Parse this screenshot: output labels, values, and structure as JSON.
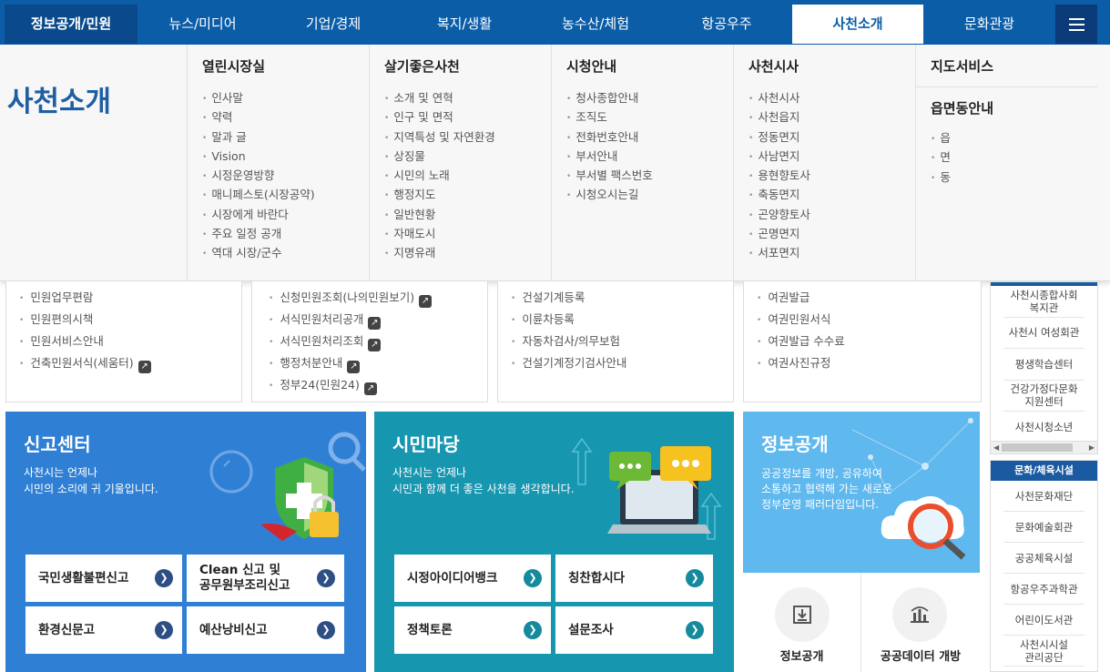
{
  "nav": {
    "items": [
      "정보공개/민원",
      "뉴스/미디어",
      "기업/경제",
      "복지/생활",
      "농수산/체험",
      "항공우주",
      "사천소개",
      "문화관광"
    ],
    "active": "사천소개"
  },
  "mega": {
    "title": "사천소개",
    "columns": [
      {
        "title": "열린시장실",
        "items": [
          "인사말",
          "약력",
          "말과 글",
          "Vision",
          "시정운영방향",
          "매니페스토(시장공약)",
          "시장에게 바란다",
          "주요 일정 공개",
          "역대 시장/군수"
        ]
      },
      {
        "title": "살기좋은사천",
        "items": [
          "소개 및 연혁",
          "인구 및 면적",
          "지역특성 및 자연환경",
          "상징물",
          "시민의 노래",
          "행정지도",
          "일반현황",
          "자매도시",
          "지명유래"
        ]
      },
      {
        "title": "시청안내",
        "items": [
          "청사종합안내",
          "조직도",
          "전화번호안내",
          "부서안내",
          "부서별 팩스번호",
          "시청오시는길"
        ]
      },
      {
        "title": "사천시사",
        "items": [
          "사천시사",
          "사천읍지",
          "정동면지",
          "사남면지",
          "용현향토사",
          "축동면지",
          "곤양향토사",
          "곤명면지",
          "서포면지"
        ]
      },
      {
        "title": "지도서비스",
        "title2": "읍면동안내",
        "items": [
          "읍",
          "면",
          "동"
        ]
      }
    ]
  },
  "boxes": [
    {
      "items": [
        {
          "t": "민원업무편람",
          "ext": false
        },
        {
          "t": "민원편의시책",
          "ext": false
        },
        {
          "t": "민원서비스안내",
          "ext": false
        },
        {
          "t": "건축민원서식(세움터)",
          "ext": true
        }
      ]
    },
    {
      "items": [
        {
          "t": "신청민원조회(나의민원보기)",
          "ext": true
        },
        {
          "t": "서식민원처리공개",
          "ext": true
        },
        {
          "t": "서식민원처리조회",
          "ext": true
        },
        {
          "t": "행정처분안내",
          "ext": true
        },
        {
          "t": "정부24(민원24)",
          "ext": true
        }
      ]
    },
    {
      "items": [
        {
          "t": "건설기계등록",
          "ext": false
        },
        {
          "t": "이륜차등록",
          "ext": false
        },
        {
          "t": "자동차검사/의무보험",
          "ext": false
        },
        {
          "t": "건설기계정기검사안내",
          "ext": false
        }
      ]
    },
    {
      "items": [
        {
          "t": "여권발급",
          "ext": false
        },
        {
          "t": "여권민원서식",
          "ext": false
        },
        {
          "t": "여권발급 수수료",
          "ext": false
        },
        {
          "t": "여권사진규정",
          "ext": false
        }
      ]
    }
  ],
  "side1": {
    "items": [
      "사천시종합사회\n복지관",
      "사천시 여성회관",
      "평생학습센터",
      "건강가정다문화\n지원센터",
      "사천시청소년"
    ]
  },
  "side2": {
    "title": "문화/체육시설",
    "items": [
      "사천문화재단",
      "문화예술회관",
      "공공체육시설",
      "항공우주과학관",
      "어린이도서관",
      "사천시시설\n관리공단"
    ]
  },
  "report": {
    "title": "신고센터",
    "desc": "사천시는 언제나\n시민의 소리에 귀 기울입니다.",
    "buttons": [
      "국민생활불편신고",
      "Clean 신고 및\n공무원부조리신고",
      "환경신문고",
      "예산낭비신고"
    ]
  },
  "citizen": {
    "title": "시민마당",
    "desc": "사천시는 언제나\n시민과 함께 더 좋은 사천을 생각합니다.",
    "buttons": [
      "시정아이디어뱅크",
      "칭찬합시다",
      "정책토론",
      "설문조사"
    ]
  },
  "info": {
    "title": "정보공개",
    "desc": "공공정보를 개방, 공유하여\n소통하고 협력해 가는 새로운\n정부운영 패러다임입니다.",
    "links": [
      "정보공개",
      "공공데이터 개방"
    ]
  },
  "colors": {
    "nav": "#0b5da8",
    "report": "#2f80d5",
    "citizen": "#1796b0",
    "info": "#5fb8ee"
  }
}
